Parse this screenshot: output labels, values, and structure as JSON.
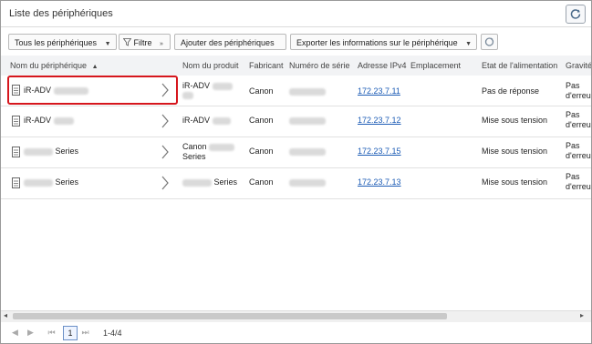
{
  "window": {
    "title": "Liste des périphériques"
  },
  "toolbar": {
    "filter_dropdown": "Tous les périphériques",
    "filter_button": "Filtre",
    "add_button": "Ajouter des périphériques",
    "export_button": "Exporter les informations sur le périphérique"
  },
  "table": {
    "columns": [
      "Nom du périphérique",
      "Nom du produit",
      "Fabricant",
      "Numéro de série",
      "Adresse IPv4",
      "Emplacement",
      "Etat de l'alimentation",
      "Gravité"
    ],
    "rows": [
      {
        "name": "iR-ADV",
        "product": "iR-ADV",
        "maker": "Canon",
        "ip": "172.23.7.11",
        "power": "Pas de réponse",
        "severity_1": "Pas",
        "severity_2": "d'erreu"
      },
      {
        "name": "iR-ADV",
        "product": "iR-ADV",
        "maker": "Canon",
        "ip": "172.23.7.12",
        "power": "Mise sous tension",
        "severity_1": "Pas",
        "severity_2": "d'erreu"
      },
      {
        "name": "Series",
        "product": "Canon",
        "product_2": "Series",
        "maker": "Canon",
        "ip": "172.23.7.15",
        "power": "Mise sous tension",
        "severity_1": "Pas",
        "severity_2": "d'erreu"
      },
      {
        "name": "Series",
        "product": "Series",
        "maker": "Canon",
        "ip": "172.23.7.13",
        "power": "Mise sous tension",
        "severity_1": "Pas",
        "severity_2": "d'erreu"
      }
    ]
  },
  "pagination": {
    "current_page": "1",
    "count": "1-4/4"
  },
  "icons": [
    "refresh-icon",
    "funnel-icon",
    "chevron-down-icon",
    "recycle-icon",
    "sort-asc-icon",
    "device-icon",
    "chevron-right-icon",
    "first-page-icon",
    "prev-page-icon",
    "next-page-icon",
    "last-page-icon",
    "scroll-left-icon",
    "scroll-right-icon"
  ]
}
